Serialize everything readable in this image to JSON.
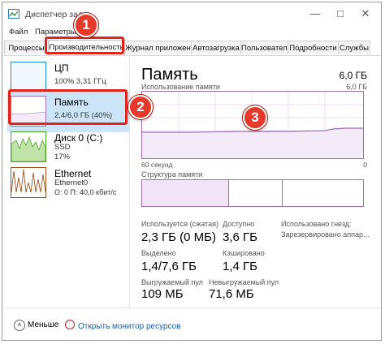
{
  "window": {
    "title": "Диспетчер зада"
  },
  "menu": [
    "Файл",
    "Параметры"
  ],
  "tabs": [
    "Процессы",
    "Производительность",
    "Журнал приложений",
    "Автозагрузка",
    "Пользователи",
    "Подробности",
    "Службы"
  ],
  "sidebar": {
    "items": [
      {
        "name": "ЦП",
        "sub1": "100%  3,31 ГГц",
        "sub2": ""
      },
      {
        "name": "Память",
        "sub1": "2,4/6,0 ГБ (40%)",
        "sub2": ""
      },
      {
        "name": "Диск 0 (C:)",
        "sub1": "SSD",
        "sub2": "17%"
      },
      {
        "name": "Ethernet",
        "sub1": "Ethernet0",
        "sub2": "О: 0  П: 40,0 кбит/с"
      }
    ]
  },
  "main": {
    "title": "Память",
    "total": "6,0 ГБ",
    "usage_label": "Использование памяти",
    "usage_max": "6,0 ГБ",
    "time_label": "60 секунд",
    "zero_label": "0",
    "structure_label": "Структура памяти",
    "stats": {
      "in_use_label": "Используется (сжатая)",
      "in_use": "2,3 ГБ (0 МБ)",
      "available_label": "Доступно",
      "available": "3,6 ГБ",
      "committed_label": "Выделено",
      "committed": "1,4/7,6 ГБ",
      "cached_label": "Кэшировано",
      "cached": "1,4 ГБ",
      "paged_label": "Выгружаемый пул",
      "paged": "109 МБ",
      "nonpaged_label": "Невыгружаемый пул",
      "nonpaged": "71,6 МБ",
      "slots_label": "Использовано гнезд:",
      "reserved_label": "Зарезервировано аппар..."
    }
  },
  "footer": {
    "less": "Меньше",
    "monitor": "Открыть монитор ресурсов"
  },
  "badges": [
    "1",
    "2",
    "3"
  ],
  "colors": {
    "memory": "#9f6fb8",
    "cpu": "#1e88d6",
    "disk": "#4ca628",
    "ethernet": "#a0531c",
    "callout": "#e53a2b"
  }
}
